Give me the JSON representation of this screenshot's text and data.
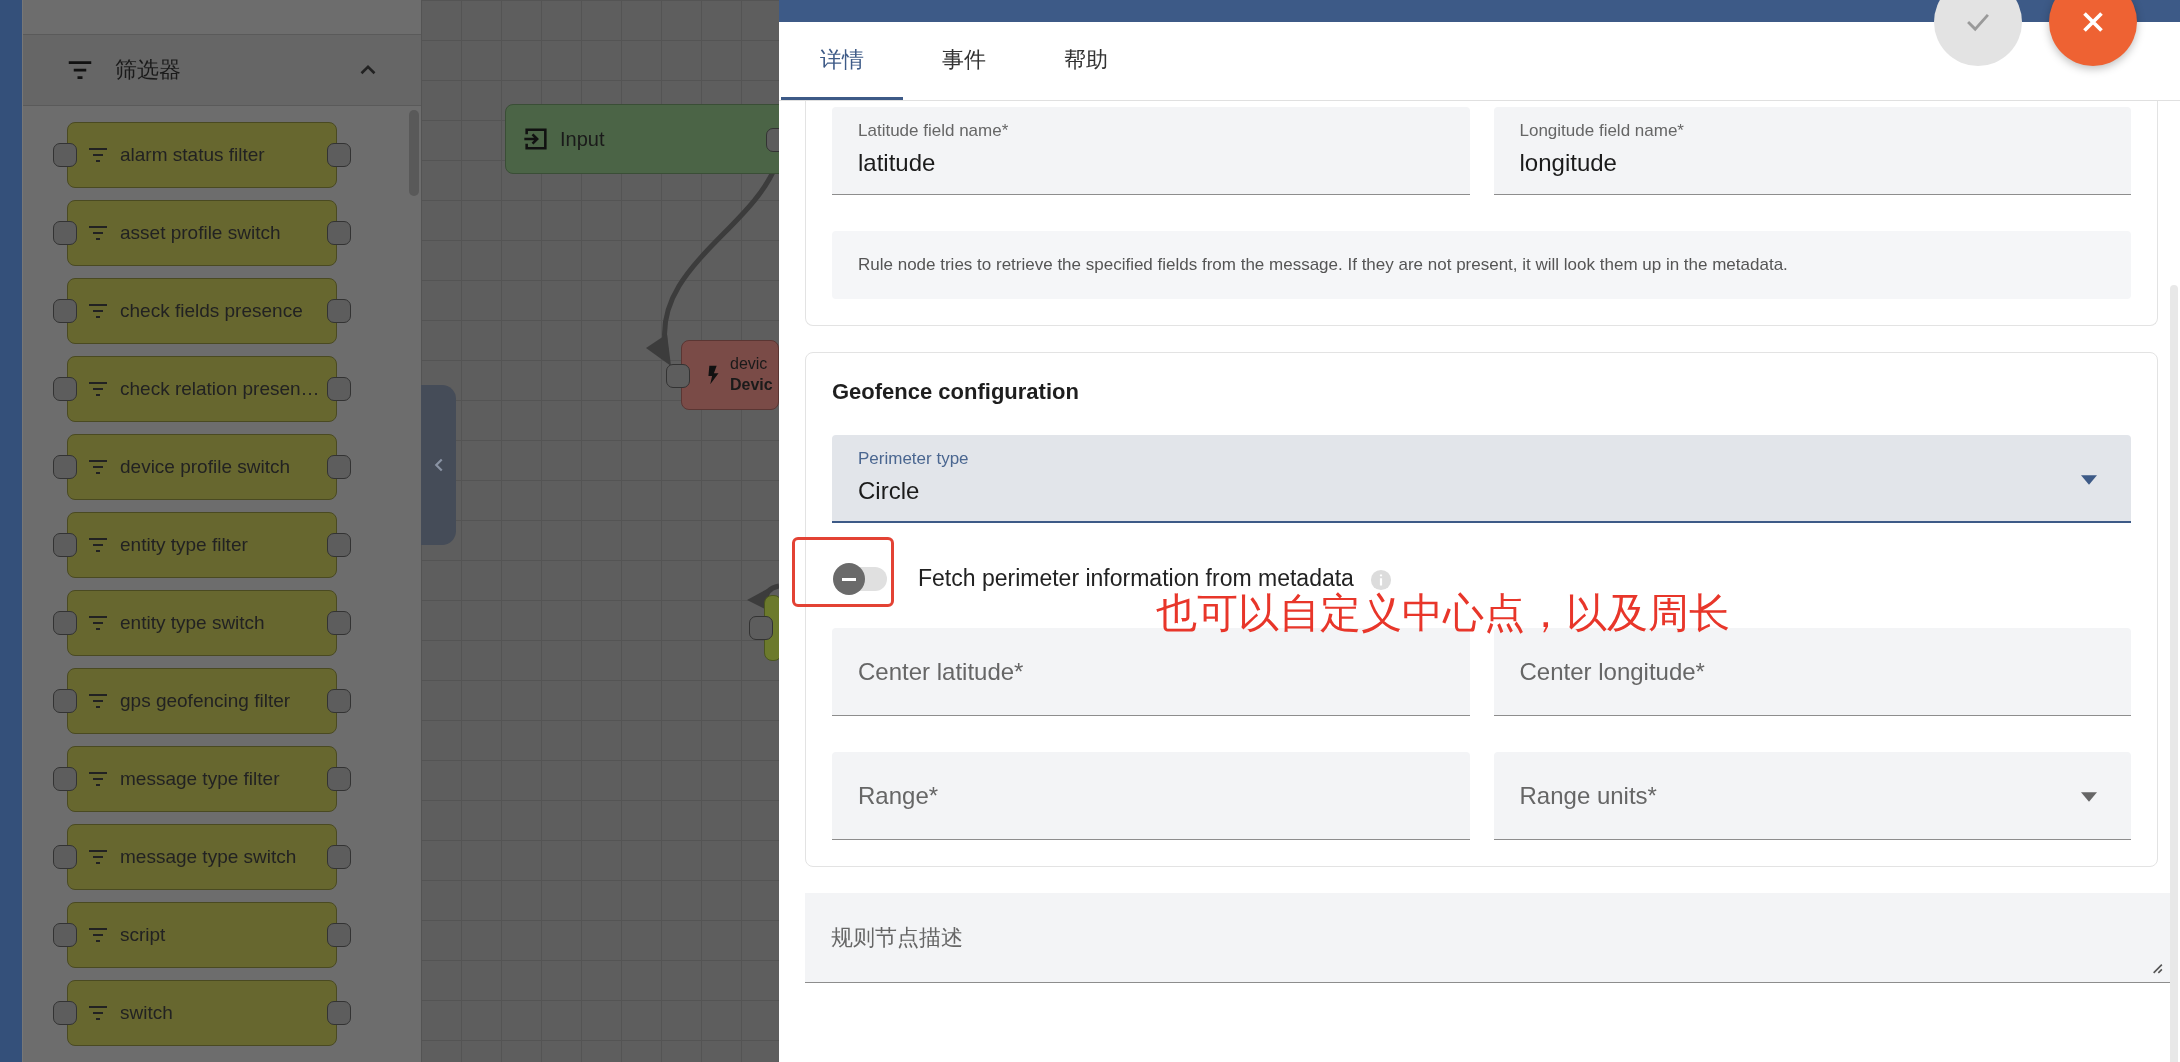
{
  "sidebar": {
    "section": {
      "title": "筛选器",
      "expanded": true
    },
    "nodes": [
      {
        "label": "alarm status filter"
      },
      {
        "label": "asset profile switch"
      },
      {
        "label": "check fields presence"
      },
      {
        "label": "check relation presen…"
      },
      {
        "label": "device profile switch"
      },
      {
        "label": "entity type filter"
      },
      {
        "label": "entity type switch"
      },
      {
        "label": "gps geofencing filter"
      },
      {
        "label": "message type filter"
      },
      {
        "label": "message type switch"
      },
      {
        "label": "script"
      },
      {
        "label": "switch"
      }
    ]
  },
  "canvas": {
    "nodes": [
      {
        "kind": "input",
        "label": "Input"
      },
      {
        "kind": "action",
        "label": "devic",
        "sublabel": "Devic"
      },
      {
        "kind": "filter"
      }
    ]
  },
  "panel": {
    "tabs": [
      {
        "label": "详情",
        "selected": true
      },
      {
        "label": "事件",
        "selected": false
      },
      {
        "label": "帮助",
        "selected": false
      }
    ],
    "source_fields": [
      {
        "label": "Latitude field name*",
        "value": "latitude"
      },
      {
        "label": "Longitude field name*",
        "value": "longitude"
      }
    ],
    "hint": "Rule node tries to retrieve the specified fields from the message. If they are not present, it will look them up in the metadata.",
    "geofence": {
      "title": "Geofence configuration",
      "perimeter_type": {
        "label": "Perimeter type",
        "value": "Circle"
      },
      "fetch_toggle": {
        "label": "Fetch perimeter information from metadata",
        "on": false
      },
      "fields": [
        {
          "kind": "text",
          "placeholder": "Center latitude*"
        },
        {
          "kind": "text",
          "placeholder": "Center longitude*"
        },
        {
          "kind": "text",
          "placeholder": "Range*"
        },
        {
          "kind": "select",
          "placeholder": "Range units*"
        }
      ]
    },
    "description": {
      "placeholder": "规则节点描述"
    }
  },
  "annotation": {
    "text": "也可以自定义中心点，以及周长"
  }
}
